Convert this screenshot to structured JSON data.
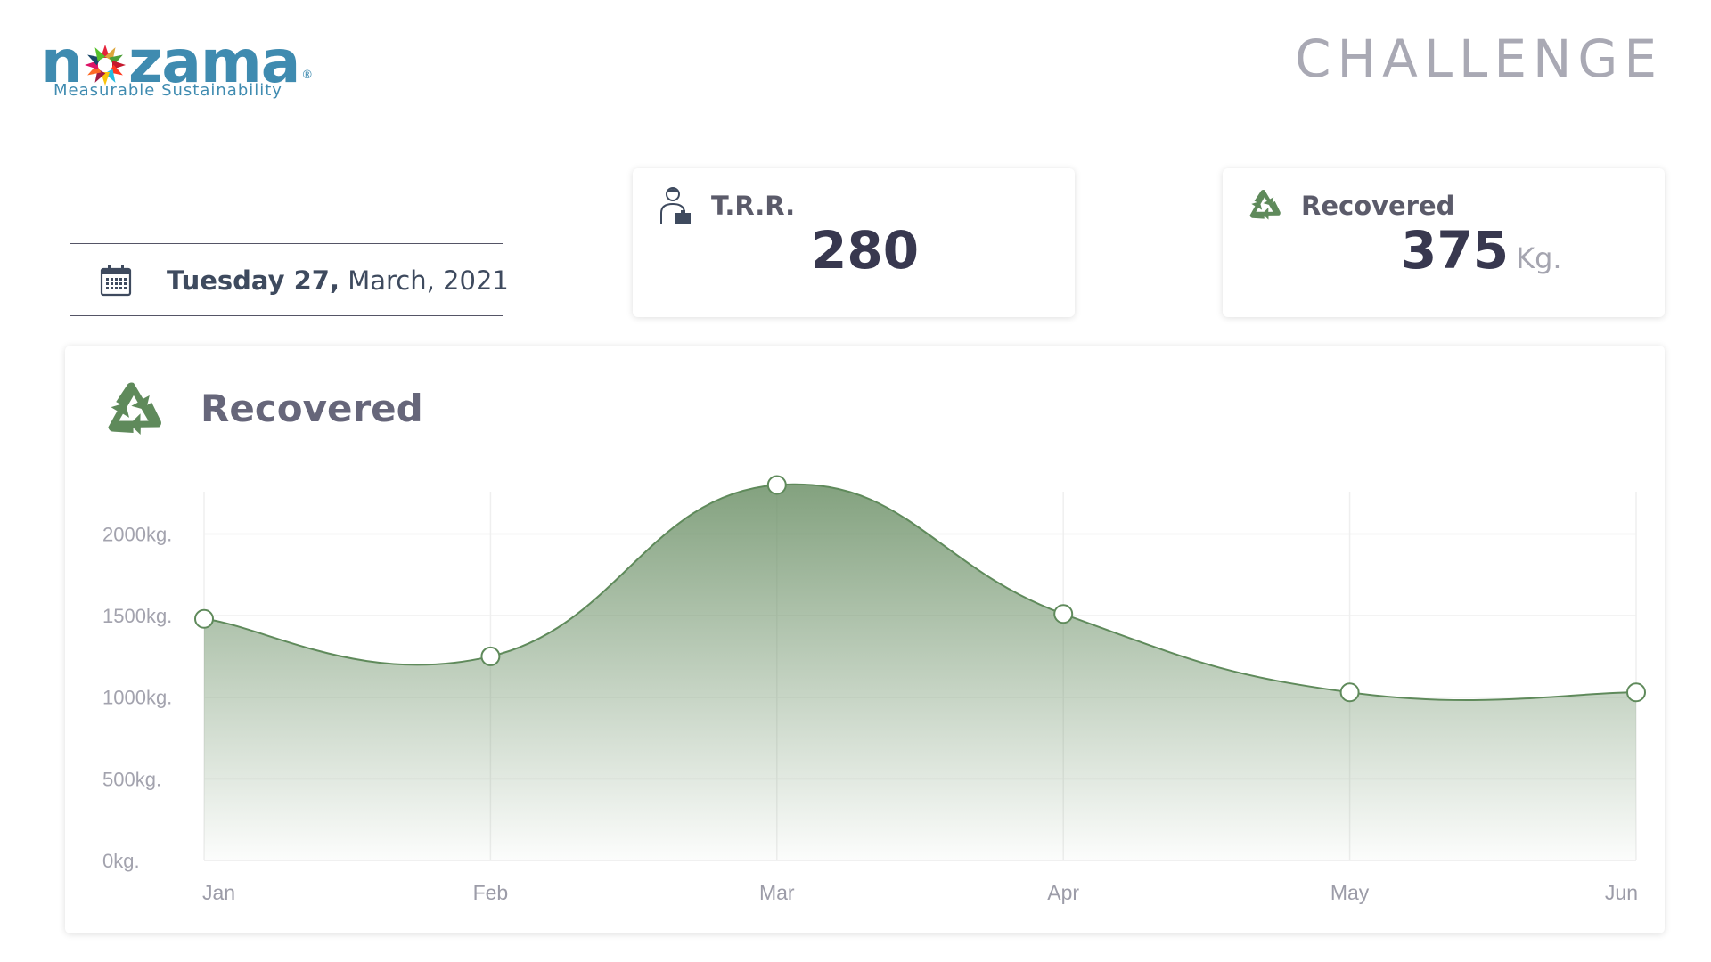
{
  "brand": {
    "logo_text_before": "n",
    "logo_text_after": "zama",
    "logo_registered": "®",
    "tagline": "Measurable Sustainability",
    "title": "CHALLENGE",
    "logo_color": "#3f8bb0"
  },
  "date": {
    "icon": "calendar-icon",
    "weekday_day": "Tuesday 27,",
    "month_year": "March, 2021"
  },
  "kpis": [
    {
      "icon": "worker-icon",
      "label": "T.R.R.",
      "value": "280",
      "unit": ""
    },
    {
      "icon": "recycle-icon",
      "label": "Recovered",
      "value": "375",
      "unit": "Kg."
    }
  ],
  "chart_card": {
    "icon": "recycle-icon",
    "title": "Recovered",
    "accent": "#5f8a5b"
  },
  "chart_data": {
    "type": "area",
    "categories": [
      "Jan",
      "Feb",
      "Mar",
      "Apr",
      "May",
      "Jun"
    ],
    "x": [
      "Jan",
      "Feb",
      "Mar",
      "Apr",
      "May",
      "Jun"
    ],
    "values": [
      1480,
      1250,
      2300,
      1510,
      1030,
      1030
    ],
    "y_ticks": [
      "0kg.",
      "500kg.",
      "1000kg.",
      "1500kg.",
      "2000kg."
    ],
    "ylim": [
      0,
      2000
    ],
    "grid": true,
    "smooth": true,
    "line_color": "#5f8a5b",
    "fill_color": "#6d9168"
  }
}
